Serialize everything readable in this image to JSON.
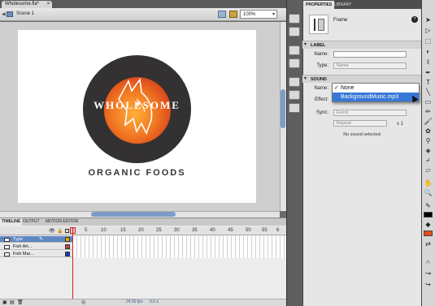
{
  "document": {
    "tab_title": "Wholesome.fla*",
    "scene": "Scene 1",
    "zoom": "100%"
  },
  "stage": {
    "brand_name": "WHOLESOME",
    "brand_tagline": "ORGANIC FOODS",
    "logo_circle_color": "#333132"
  },
  "timeline": {
    "tabs": [
      "TIMELINE",
      "OUTPUT",
      "MOTION EDITOR"
    ],
    "frame_numbers": [
      "5",
      "10",
      "15",
      "20",
      "25",
      "30",
      "35",
      "40",
      "45",
      "50",
      "55",
      "6"
    ],
    "layers": [
      {
        "name": "Type",
        "selected": true
      },
      {
        "name": "Fish Art...",
        "selected": false
      },
      {
        "name": "Fish Mar...",
        "selected": false
      }
    ],
    "fps": "24.00 fps",
    "time": "0.0 s"
  },
  "properties": {
    "tabs": [
      "PROPERTIES",
      "LIBRARY"
    ],
    "object_type": "Frame",
    "label_section": {
      "header": "LABEL",
      "name_label": "Name:",
      "type_label": "Type:",
      "type_value": "Name"
    },
    "sound_section": {
      "header": "SOUND",
      "name_label": "Name:",
      "effect_label": "Effect:",
      "sync_label": "Sync:",
      "sync_value": "Event",
      "repeat_value": "Repeat",
      "repeat_count": "x 1",
      "status": "No sound selected",
      "dropdown_options": [
        "None",
        "BackgroundMusic.mp3"
      ],
      "checked_option": "None",
      "highlighted_option": "BackgroundMusic.mp3"
    }
  },
  "colors": {
    "selection_blue": "#3877d6",
    "playhead_red": "#d12222",
    "fill_color": "#e3501a"
  }
}
